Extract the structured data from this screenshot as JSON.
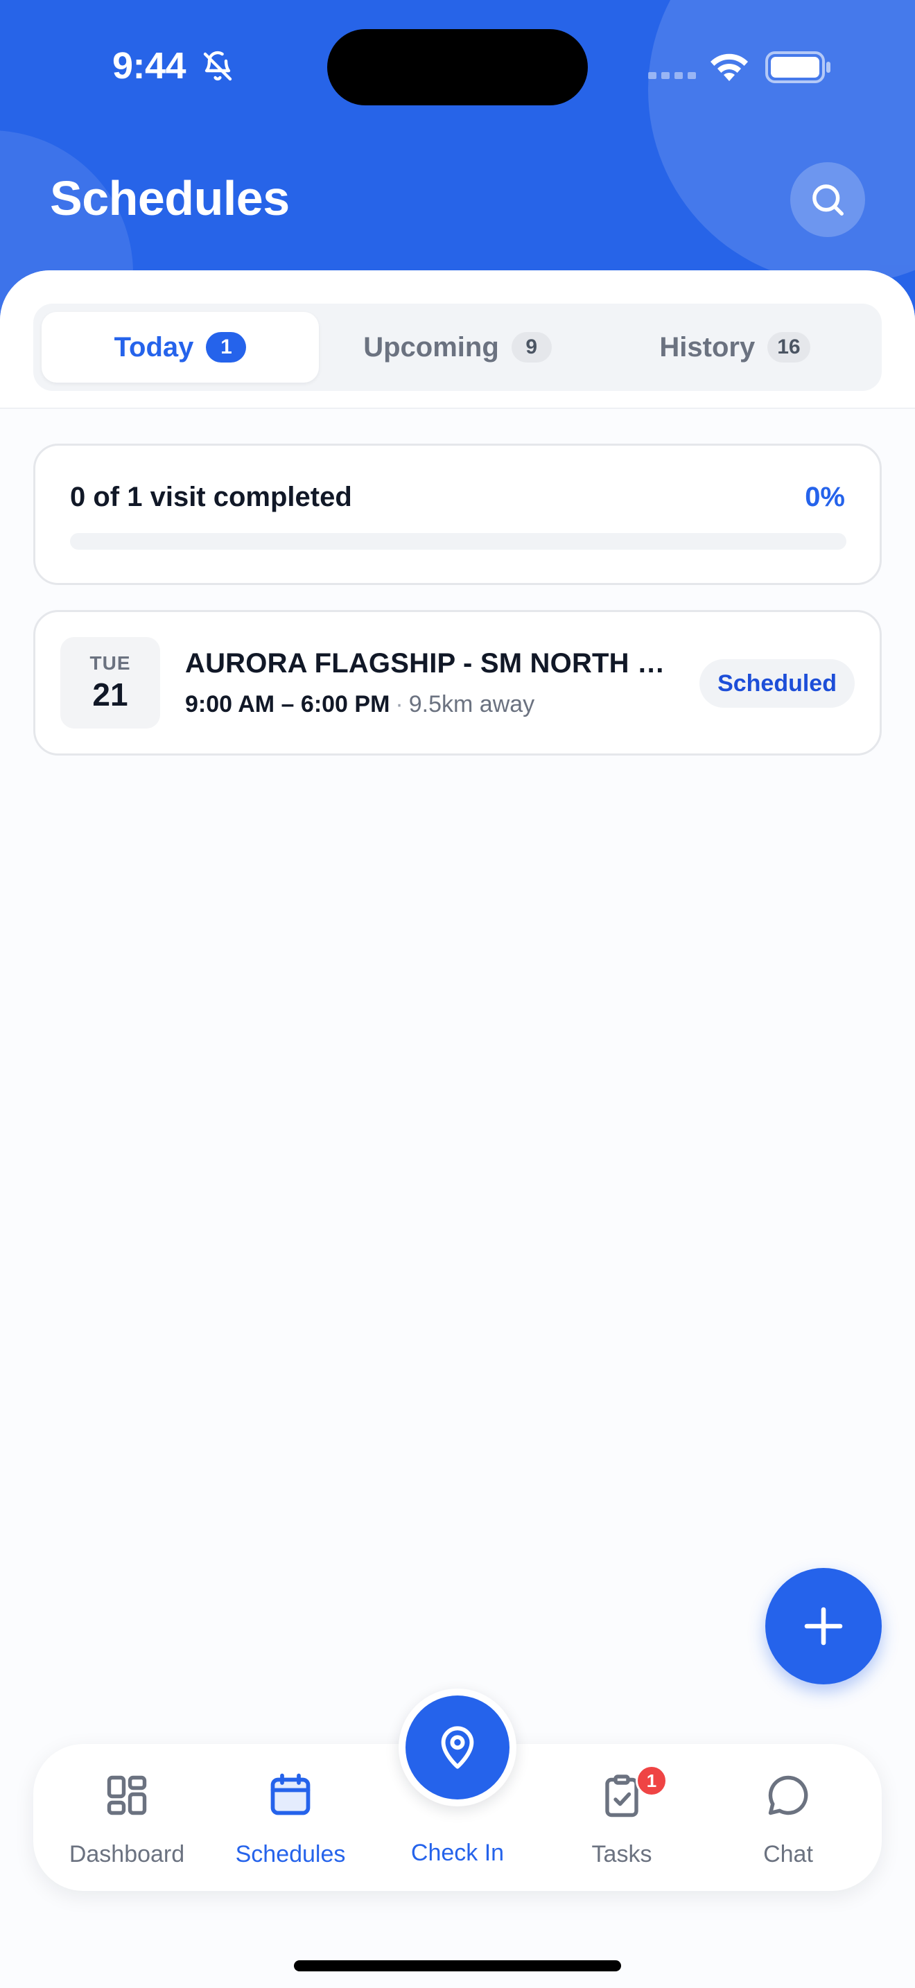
{
  "status_bar": {
    "time": "9:44"
  },
  "header": {
    "title": "Schedules"
  },
  "tabs": [
    {
      "label": "Today",
      "count": "1",
      "active": true
    },
    {
      "label": "Upcoming",
      "count": "9",
      "active": false
    },
    {
      "label": "History",
      "count": "16",
      "active": false
    }
  ],
  "progress": {
    "label": "0 of 1 visit completed",
    "percent_text": "0%",
    "fraction": 0
  },
  "visits": [
    {
      "weekday": "TUE",
      "day": "21",
      "title": "AURORA FLAGSHIP - SM NORTH E...",
      "time": "9:00 AM – 6:00 PM",
      "separator": "·",
      "distance": "9.5km away",
      "status": "Scheduled"
    }
  ],
  "nav": {
    "dashboard": "Dashboard",
    "schedules": "Schedules",
    "checkin": "Check In",
    "tasks": "Tasks",
    "tasks_badge": "1",
    "chat": "Chat"
  },
  "icons": {
    "search": "search-icon",
    "add": "plus-icon",
    "dashboard": "grid-icon",
    "schedules": "calendar-icon",
    "checkin": "map-pin-icon",
    "tasks": "clipboard-check-icon",
    "chat": "chat-bubble-icon"
  },
  "colors": {
    "primary": "#2563eb",
    "header": "#2764e8",
    "badge_alert": "#ef4444"
  }
}
